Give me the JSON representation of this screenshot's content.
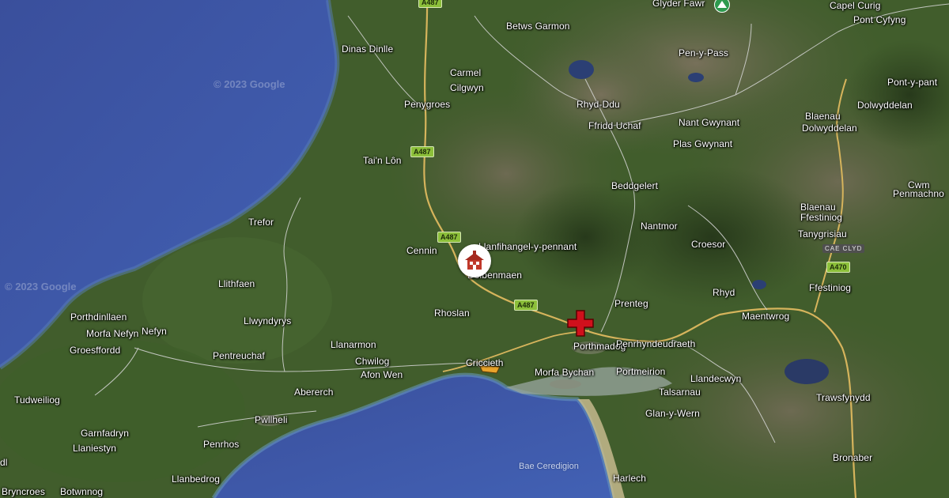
{
  "map": {
    "attribution": [
      "© 2023 Google",
      "© 2023 Google"
    ],
    "sea_label": "Bae Ceredigion",
    "area_code": "CAE CLYD",
    "roads": [
      "A487",
      "A487",
      "A487",
      "A487",
      "A470"
    ],
    "colors": {
      "sea": "#3c56a6",
      "land": "#3f5a2c",
      "road": "#d8b860",
      "minor_road": "#cfcfcf",
      "marker_red": "#d0101c"
    },
    "markers": [
      {
        "name": "school",
        "icon": "schoolhouse-icon",
        "label": "Llanfihangel-y-pennant"
      },
      {
        "name": "hospital",
        "icon": "red-cross-icon"
      },
      {
        "name": "peak",
        "icon": "mountain-icon",
        "label": "Glyder Fawr"
      }
    ],
    "places": [
      "Glyder Fawr",
      "Capel Curig",
      "Pont Cyfyng",
      "Betws Garmon",
      "Dinas Dinlle",
      "Pen-y-Pass",
      "Carmel",
      "Cilgwyn",
      "Pont-y-pant",
      "Penygroes",
      "Rhyd-Ddu",
      "Blaenau",
      "Dolwyddelan",
      "Dolwyddelan",
      "Ffridd Uchaf",
      "Nant Gwynant",
      "Plas Gwynant",
      "Tai'n Lôn",
      "Cwm",
      "Penmachno",
      "Beddgelert",
      "Blaenau",
      "Ffestiniog",
      "Trefor",
      "Nantmor",
      "Tanygrisiau",
      "Cennin",
      "Llanfihangel-y-pennant",
      "Croesor",
      "Dolbenmaen",
      "Llithfaen",
      "Ffestiniog",
      "Rhyd",
      "Prenteg",
      "Porthdinllaen",
      "Morfa Nefyn",
      "Nefyn",
      "Rhoslan",
      "Porthmadog",
      "Maentwrog",
      "Llwyndyrys",
      "Penrhyndeudraeth",
      "Groesffordd",
      "Llanarmon",
      "Pentreuchaf",
      "Chwilog",
      "Criccieth",
      "Morfa Bychan",
      "Portmeirion",
      "Llandecwyn",
      "Afon Wen",
      "Talsarnau",
      "Tudweiliog",
      "Abererch",
      "Trawsfynydd",
      "Pwllheli",
      "Glan-y-Wern",
      "Garnfadryn",
      "Llaniestyn",
      "Penrhos",
      "Llanbedrog",
      "Botwnnog",
      "Bryncroes",
      "Harlech",
      "Bronaber",
      "dl"
    ]
  }
}
